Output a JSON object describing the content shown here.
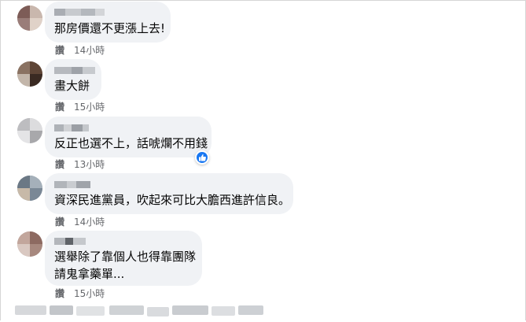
{
  "comments": [
    {
      "text_lines": [
        "那房價還不更漲上去!"
      ],
      "like_label": "讚",
      "time": "14小時"
    },
    {
      "text_lines": [
        "畫大餅"
      ],
      "like_label": "讚",
      "time": "15小時"
    },
    {
      "text_lines": [
        "反正也選不上，話唬爛不用錢"
      ],
      "like_label": "讚",
      "time": "13小時",
      "reaction": "like-reaction-icon"
    },
    {
      "text_lines": [
        "資深民進黨員，吹起來可比大膽西進許信良。"
      ],
      "like_label": "讚",
      "time": "14小時"
    },
    {
      "text_lines": [
        "選舉除了靠個人也得靠團隊",
        "請鬼拿藥單..."
      ],
      "like_label": "讚",
      "time": "15小時"
    }
  ],
  "colors": {
    "bubble": "#f0f2f5",
    "meta": "#65676b",
    "text": "#050505",
    "reaction": "#1877f2"
  }
}
